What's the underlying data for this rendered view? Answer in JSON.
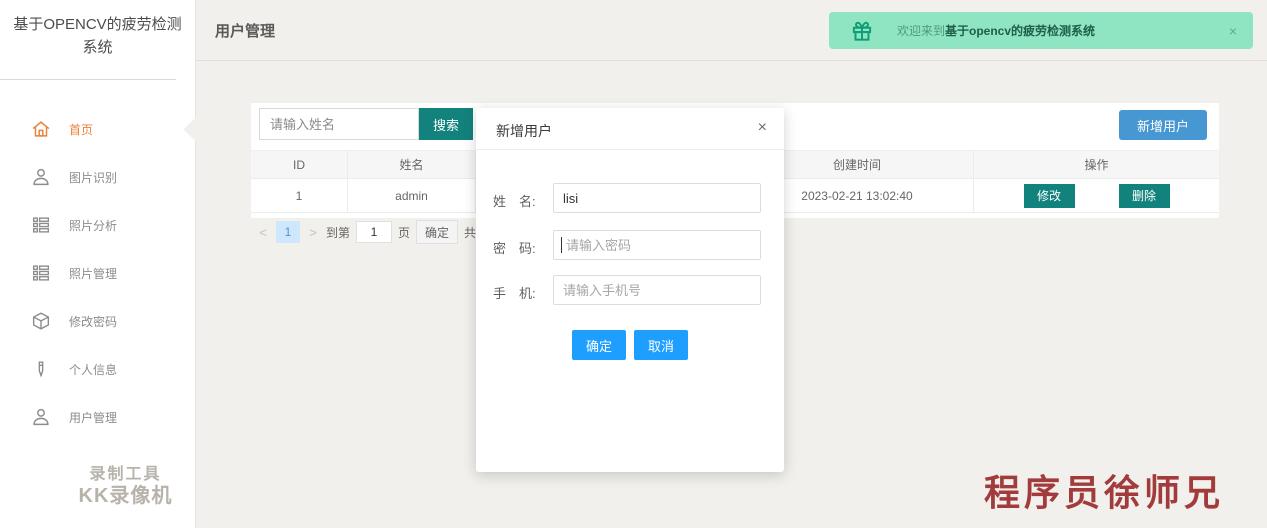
{
  "colors": {
    "accent_teal": "#12827C",
    "accent_blue": "#4797D2",
    "modal_blue": "#1E9FFF",
    "banner_bg": "#8FE5C2",
    "banner_dark_text": "#1E5F4A",
    "active_orange": "#E8833A",
    "bg_beige": "#F2F0EC",
    "watermark_red": "#A23C3C"
  },
  "sidebar": {
    "title": "基于OPENCV的疲劳检测系统",
    "items": [
      {
        "label": "首页"
      },
      {
        "label": "图片识别"
      },
      {
        "label": "照片分析"
      },
      {
        "label": "照片管理"
      },
      {
        "label": "修改密码"
      },
      {
        "label": "个人信息"
      },
      {
        "label": "用户管理"
      }
    ],
    "watermark_line1": "录制工具",
    "watermark_line2": "KK录像机"
  },
  "header": {
    "page_title": "用户管理",
    "banner": {
      "text_prefix": "欢迎来到",
      "text_bold": "基于opencv的疲劳检测系统",
      "close_label": "×"
    }
  },
  "toolbar": {
    "search_placeholder": "请输入姓名",
    "search_button": "搜索",
    "add_user_button": "新增用户"
  },
  "table": {
    "columns": [
      "ID",
      "姓名",
      "创建时间",
      "操作"
    ],
    "rows": [
      {
        "id": "1",
        "name": "admin",
        "created": "2023-02-21 13:02:40"
      }
    ],
    "edit_button": "修改",
    "delete_button": "删除"
  },
  "pagination": {
    "prev": "<",
    "current_page": "1",
    "next": ">",
    "goto_prefix": "到第",
    "goto_value": "1",
    "goto_suffix": "页",
    "confirm_button": "确定",
    "total_partial": "共"
  },
  "modal": {
    "title": "新增用户",
    "close_label": "×",
    "fields": [
      {
        "label": "姓　名:",
        "value": "lisi",
        "placeholder": ""
      },
      {
        "label": "密　码:",
        "value": "",
        "placeholder": "请输入密码"
      },
      {
        "label": "手　机:",
        "value": "",
        "placeholder": "请输入手机号"
      }
    ],
    "confirm_button": "确定",
    "cancel_button": "取消"
  },
  "watermark_bottom_right": "程序员徐师兄"
}
